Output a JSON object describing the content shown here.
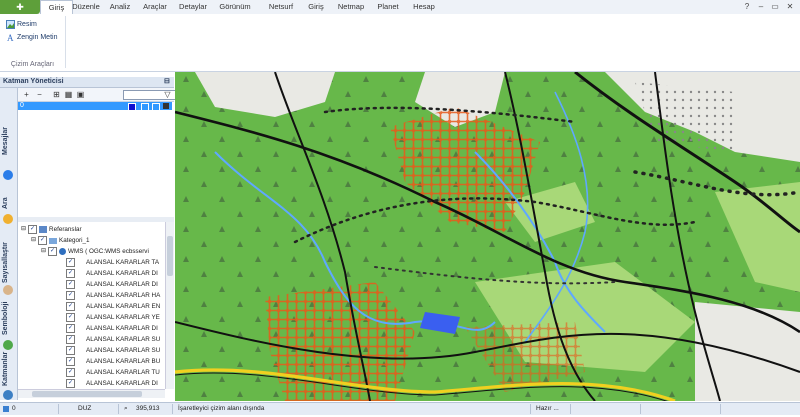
{
  "app_button_label": "✚",
  "menu": {
    "tabs": [
      "Giriş",
      "Düzenle",
      "Analiz",
      "Araçlar",
      "Detaylar",
      "Görünüm",
      "Netsurf",
      "Giriş",
      "Netmap",
      "Planet",
      "Hesap"
    ],
    "active_tab": "Giriş"
  },
  "window_controls": {
    "help": "?",
    "minimize": "–",
    "restore": "▭",
    "close": "✕"
  },
  "ribbon": {
    "group_caption": "Çizim Araçları",
    "buttons": [
      {
        "label": "Resim",
        "icon": "image-icon"
      },
      {
        "label": "Zengin Metin",
        "icon": "rich-text-icon"
      }
    ]
  },
  "layer_manager": {
    "title": "Katman Yöneticisi",
    "pin_glyph": "⊟",
    "layers": [
      {
        "name": "0",
        "color": "#1010d0"
      }
    ],
    "toolbar_icons": [
      "add-layer-icon",
      "remove-layer-icon",
      "layer-properties-icon",
      "layer-group-icon",
      "lock-icon",
      "filter-icon"
    ]
  },
  "side_tabs": [
    {
      "label": "Mesajlar",
      "icon": "info-icon"
    },
    {
      "label": "Ara",
      "icon": "search-icon"
    },
    {
      "label": "Sayısallaştır",
      "icon": "hand-icon"
    },
    {
      "label": "Semboloji",
      "icon": "symbology-icon"
    },
    {
      "label": "Katmanlar",
      "icon": "layers-icon"
    }
  ],
  "tree": {
    "root": "Referanslar",
    "category": "Kategori_1",
    "service": "WMS ( OGC:WMS ecbsservi",
    "items": [
      "ALANSAL KARARLAR TA",
      "ALANSAL KARARLAR DI",
      "ALANSAL KARARLAR DI",
      "ALANSAL KARARLAR HA",
      "ALANSAL KARARLAR EN",
      "ALANSAL KARARLAR YE",
      "ALANSAL KARARLAR DI",
      "ALANSAL KARARLAR SU",
      "ALANSAL KARARLAR SU",
      "ALANSAL KARARLAR BU",
      "ALANSAL KARARLAR TU",
      "ALANSAL KARARLAR DI"
    ]
  },
  "status": {
    "value_left": "0",
    "mode": "DUZ",
    "coordinate": "395,913",
    "message": "İşaretleyici çizim alanı dışında",
    "ready": "Hazır ..."
  },
  "colors": {
    "map_green": "#67b84a",
    "map_light_green": "#a8d878",
    "map_grey": "#e9e9e4",
    "road": "#111111",
    "water": "#5fa8ff",
    "hatch": "#e85a1a",
    "highway": "#f0d020",
    "selection": "#3399ff"
  }
}
